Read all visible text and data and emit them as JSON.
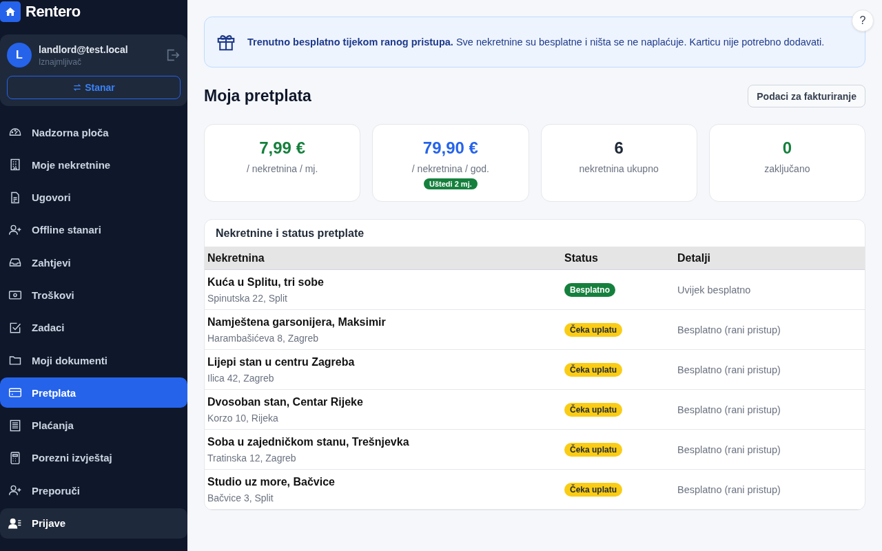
{
  "brand": "Rentero",
  "account": {
    "avatar": "L",
    "email": "landlord@test.local",
    "role": "Iznajmljivač",
    "switch_button": "Stanar"
  },
  "nav": [
    {
      "label": "Nadzorna ploča",
      "selected": false,
      "hovered": false
    },
    {
      "label": "Moje nekretnine",
      "selected": false,
      "hovered": false
    },
    {
      "label": "Ugovori",
      "selected": false,
      "hovered": false
    },
    {
      "label": "Offline stanari",
      "selected": false,
      "hovered": false
    },
    {
      "label": "Zahtjevi",
      "selected": false,
      "hovered": false
    },
    {
      "label": "Troškovi",
      "selected": false,
      "hovered": false
    },
    {
      "label": "Zadaci",
      "selected": false,
      "hovered": false
    },
    {
      "label": "Moji dokumenti",
      "selected": false,
      "hovered": false
    },
    {
      "label": "Pretplata",
      "selected": true,
      "hovered": false
    },
    {
      "label": "Plaćanja",
      "selected": false,
      "hovered": false
    },
    {
      "label": "Porezni izvještaj",
      "selected": false,
      "hovered": false
    },
    {
      "label": "Preporuči",
      "selected": false,
      "hovered": false
    },
    {
      "label": "Prijave",
      "selected": false,
      "hovered": true
    }
  ],
  "help_button": "?",
  "banner": {
    "text": "**Trenutno besplatno tijekom ranog pristupa.** Sve nekretnine su besplatne i ništa se ne naplaćuje. Karticu nije potrebno dodavati."
  },
  "page_title": "Moja pretplata",
  "billing_button": "Podaci za fakturiranje",
  "stats": [
    {
      "value": "7,99 €",
      "label": "/ nekretnina / mj.",
      "color": "#15803d"
    },
    {
      "value": "79,90 €",
      "label": "/ nekretnina / god.",
      "color": "#2563eb",
      "badge": "Uštedi 2 mj."
    },
    {
      "value": "6",
      "label": "nekretnina ukupno",
      "color": "#1f2937"
    },
    {
      "value": "0",
      "label": "zaključano",
      "color": "#15803d"
    }
  ],
  "table": {
    "title": "Nekretnine i status pretplate",
    "columns": [
      "Nekretnina",
      "Status",
      "Detalji"
    ],
    "rows": [
      {
        "name": "Kuća u Splitu, tri sobe",
        "address": "Spinutska 22, Split",
        "status": "Besplatno",
        "kind": "free",
        "details": "Uvijek besplatno"
      },
      {
        "name": "Namještena garsonijera, Maksimir",
        "address": "Harambašićeva 8, Zagreb",
        "status": "Čeka uplatu",
        "kind": "pending",
        "details": "Besplatno (rani pristup)"
      },
      {
        "name": "Lijepi stan u centru Zagreba",
        "address": "Ilica 42, Zagreb",
        "status": "Čeka uplatu",
        "kind": "pending",
        "details": "Besplatno (rani pristup)"
      },
      {
        "name": "Dvosoban stan, Centar Rijeke",
        "address": "Korzo 10, Rijeka",
        "status": "Čeka uplatu",
        "kind": "pending",
        "details": "Besplatno (rani pristup)"
      },
      {
        "name": "Soba u zajedničkom stanu, Trešnjevka",
        "address": "Tratinska 12, Zagreb",
        "status": "Čeka uplatu",
        "kind": "pending",
        "details": "Besplatno (rani pristup)"
      },
      {
        "name": "Studio uz more, Bačvice",
        "address": "Bačvice 3, Split",
        "status": "Čeka uplatu",
        "kind": "pending",
        "details": "Besplatno (rani pristup)"
      }
    ]
  }
}
